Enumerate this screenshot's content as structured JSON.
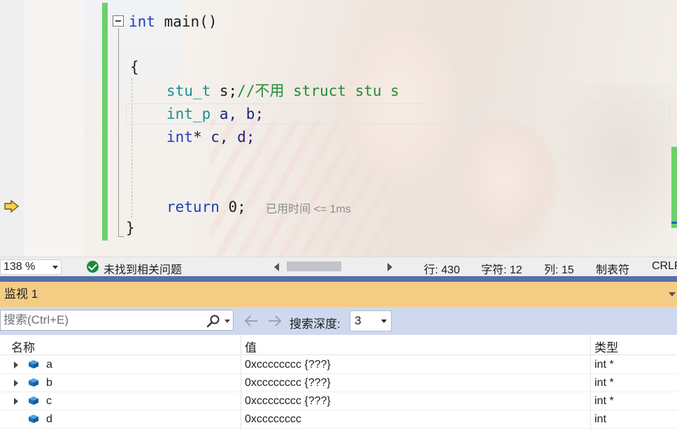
{
  "editor": {
    "lines": {
      "main_kw": "int",
      "main_name": "main",
      "main_parens": "()",
      "open_brace": "{",
      "l1_type": "stu_t",
      "l1_var": "s;",
      "l1_comment": "//不用 struct stu s",
      "l2_type": "int_p",
      "l2_vars": "a, b;",
      "l3_kw": "int",
      "l3_star": "*",
      "l3_vars": "c, d;",
      "ret_kw": "return",
      "ret_val": "0;",
      "elapsed_hint": "已用时间 <= 1ms",
      "close_brace": "}"
    }
  },
  "statusbar": {
    "zoom": "138 %",
    "issues": "未找到相关问题",
    "line": "行: 430",
    "char": "字符: 12",
    "col": "列: 15",
    "tabs": "制表符",
    "eol": "CRLF"
  },
  "watch": {
    "title": "监视 1",
    "search_placeholder": "搜索(Ctrl+E)",
    "depth_label": "搜索深度:",
    "depth_value": "3",
    "columns": {
      "name": "名称",
      "value": "值",
      "type": "类型"
    },
    "rows": [
      {
        "name": "a",
        "value": "0xcccccccc {???}",
        "type": "int *"
      },
      {
        "name": "b",
        "value": "0xcccccccc {???}",
        "type": "int *"
      },
      {
        "name": "c",
        "value": "0xcccccccc {???}",
        "type": "int *"
      },
      {
        "name": "d",
        "value": "0xcccccccc",
        "type": "int"
      }
    ]
  },
  "colors": {
    "change_bar": "#6ad16a",
    "watch_title_bg": "#f5cc84",
    "toolbar_bg": "#ced8ef",
    "keyword": "#1c3fb8",
    "comment": "#238c36"
  },
  "icons": [
    "current-statement-arrow-icon",
    "fold-collapse-icon",
    "check-circle-icon",
    "search-icon",
    "back-arrow-icon",
    "forward-arrow-icon",
    "variable-cube-icon",
    "expand-triangle-icon"
  ]
}
